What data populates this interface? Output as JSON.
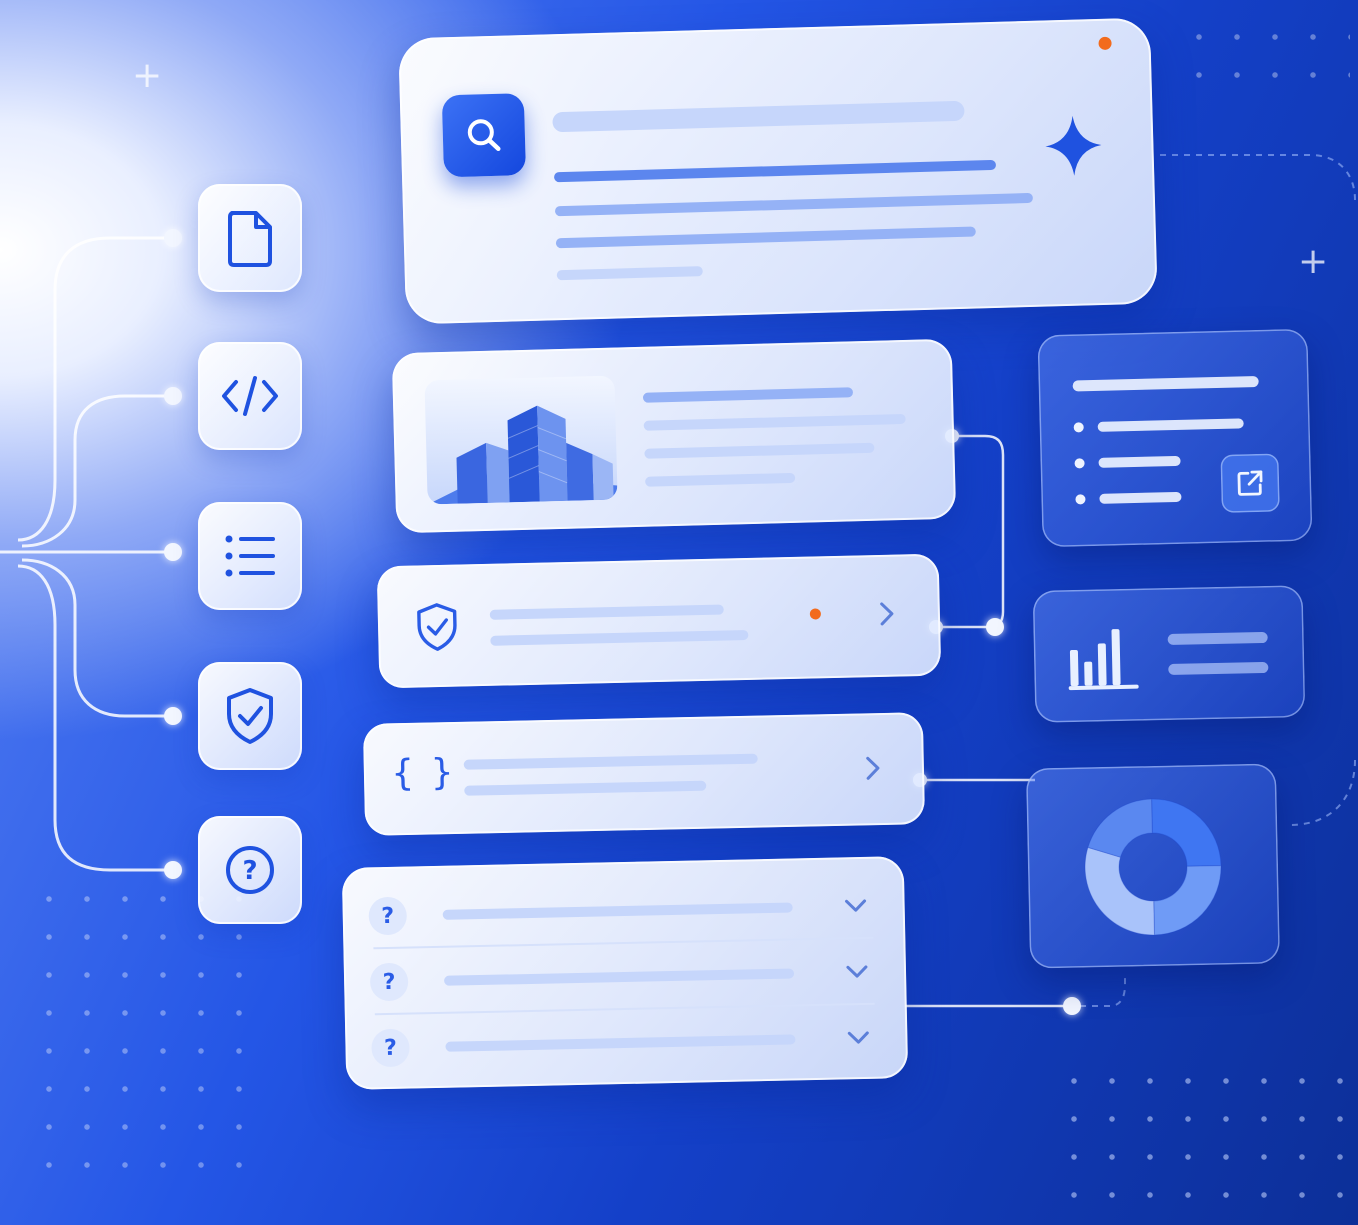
{
  "faq": {
    "items": [
      {
        "marker": "?"
      },
      {
        "marker": "?"
      },
      {
        "marker": "?"
      }
    ]
  },
  "code_row": {
    "glyph": "{ }"
  },
  "help_glyph": "?",
  "colors": {
    "accent": "#2a5ce6",
    "notification": "#f26b1d",
    "background_dark": "#0c2f98"
  },
  "icons": [
    "search-icon",
    "sparkle-icon",
    "document-icon",
    "code-icon",
    "list-icon",
    "shield-check-icon",
    "help-icon",
    "external-link-icon",
    "bar-chart-icon",
    "donut-chart-icon",
    "chevron-right-icon",
    "chevron-down-icon",
    "plus-icon"
  ],
  "chart_data": [
    {
      "type": "pie",
      "values": [
        25,
        25,
        30,
        20
      ]
    }
  ]
}
